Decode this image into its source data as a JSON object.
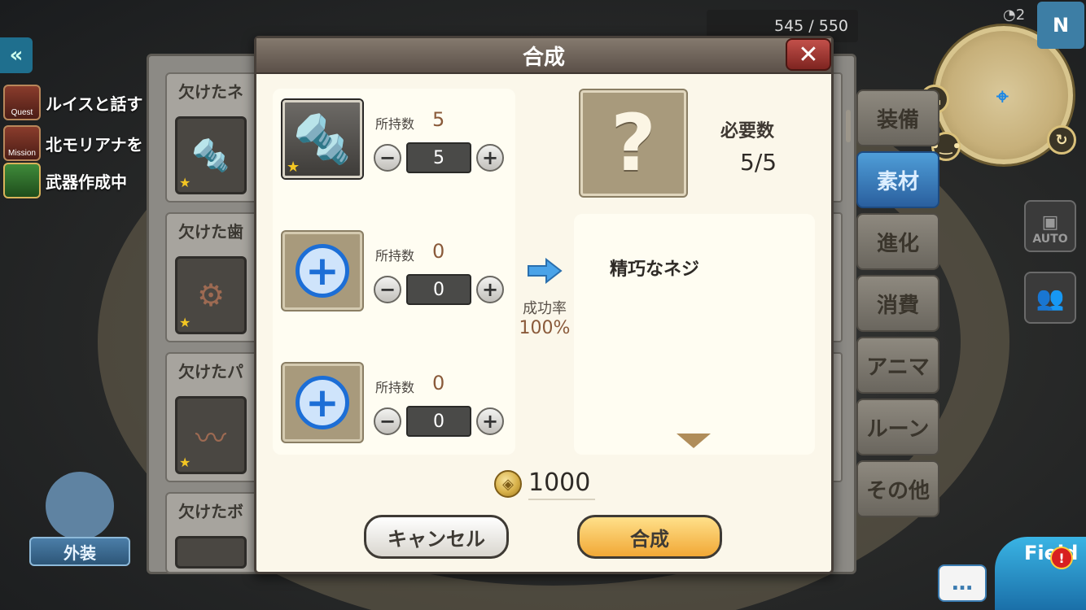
{
  "hud": {
    "capacity_counter": "545 / 550",
    "timer_text": "2",
    "compass_label": "N",
    "quests": [
      {
        "icon_label": "Quest",
        "text": "ルイスと話す"
      },
      {
        "icon_label": "Mission",
        "text": "北モリアナを"
      },
      {
        "icon_label": "",
        "text": "武器作成中"
      }
    ],
    "auto_label": "AUTO",
    "outfit_label": "外装",
    "field_label": "Field",
    "chat_label": "…",
    "alert_label": "!"
  },
  "category_tabs": [
    {
      "label": "装備",
      "active": false
    },
    {
      "label": "素材",
      "active": true
    },
    {
      "label": "進化",
      "active": false
    },
    {
      "label": "消費",
      "active": false
    },
    {
      "label": "アニマ",
      "active": false
    },
    {
      "label": "ルーン",
      "active": false
    },
    {
      "label": "その他",
      "active": false
    }
  ],
  "inventory": [
    {
      "name": "欠けたネ",
      "icon": "broken-screw-icon"
    },
    {
      "name": "欠けた歯",
      "icon": "broken-gear-icon"
    },
    {
      "name": "欠けたパ",
      "icon": "broken-pipe-icon"
    },
    {
      "name": "欠けたボ",
      "icon": "broken-bolt-icon"
    }
  ],
  "dialog": {
    "title": "合成",
    "close_symbol": "✕",
    "materials": [
      {
        "owned_label": "所持数",
        "owned": "5",
        "qty": "5",
        "filled": true,
        "icon": "broken-screw-icon"
      },
      {
        "owned_label": "所持数",
        "owned": "0",
        "qty": "0",
        "filled": false,
        "icon": "add-slot-icon"
      },
      {
        "owned_label": "所持数",
        "owned": "0",
        "qty": "0",
        "filled": false,
        "icon": "add-slot-icon"
      }
    ],
    "minus_symbol": "−",
    "plus_symbol": "+",
    "success_rate_label": "成功率",
    "success_rate": "100%",
    "result_symbol": "?",
    "required_label": "必要数",
    "required_value": "5/5",
    "result_name": "精巧なネジ",
    "cost": "1000",
    "cancel_label": "キャンセル",
    "confirm_label": "合成"
  },
  "colors": {
    "accent_blue": "#1c6ed6",
    "active_tab": "#2a5f9e",
    "confirm_button": "#f1a836",
    "header": "#5b5048"
  }
}
